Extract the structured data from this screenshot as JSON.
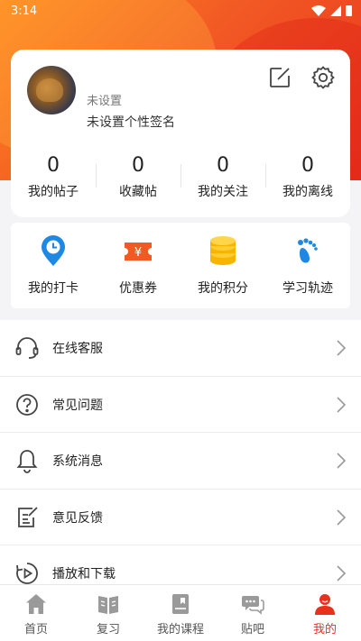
{
  "status_bar": {
    "time": "3:14"
  },
  "profile": {
    "nickname": "未设置",
    "signature": "未设置个性签名",
    "stats": [
      {
        "count": "0",
        "label": "我的帖子"
      },
      {
        "count": "0",
        "label": "收藏帖"
      },
      {
        "count": "0",
        "label": "我的关注"
      },
      {
        "count": "0",
        "label": "我的离线"
      }
    ]
  },
  "quick_actions": [
    {
      "label": "我的打卡",
      "icon": "location-clock-icon"
    },
    {
      "label": "优惠券",
      "icon": "coupon-icon"
    },
    {
      "label": "我的积分",
      "icon": "coins-icon"
    },
    {
      "label": "学习轨迹",
      "icon": "footprint-icon"
    }
  ],
  "menu": [
    {
      "label": "在线客服",
      "icon": "headset-icon"
    },
    {
      "label": "常见问题",
      "icon": "question-icon"
    },
    {
      "label": "系统消息",
      "icon": "bell-icon"
    },
    {
      "label": "意见反馈",
      "icon": "feedback-icon"
    },
    {
      "label": "播放和下载",
      "icon": "play-download-icon"
    }
  ],
  "tabs": [
    {
      "label": "首页",
      "icon": "home-icon"
    },
    {
      "label": "复习",
      "icon": "book-icon"
    },
    {
      "label": "我的课程",
      "icon": "course-icon"
    },
    {
      "label": "贴吧",
      "icon": "chat-icon"
    },
    {
      "label": "我的",
      "icon": "user-icon"
    }
  ],
  "colors": {
    "accent": "#e8311d",
    "header_orange": "#ff8a1f",
    "icon_blue": "#1e88e5",
    "coin_yellow": "#f7b500"
  }
}
